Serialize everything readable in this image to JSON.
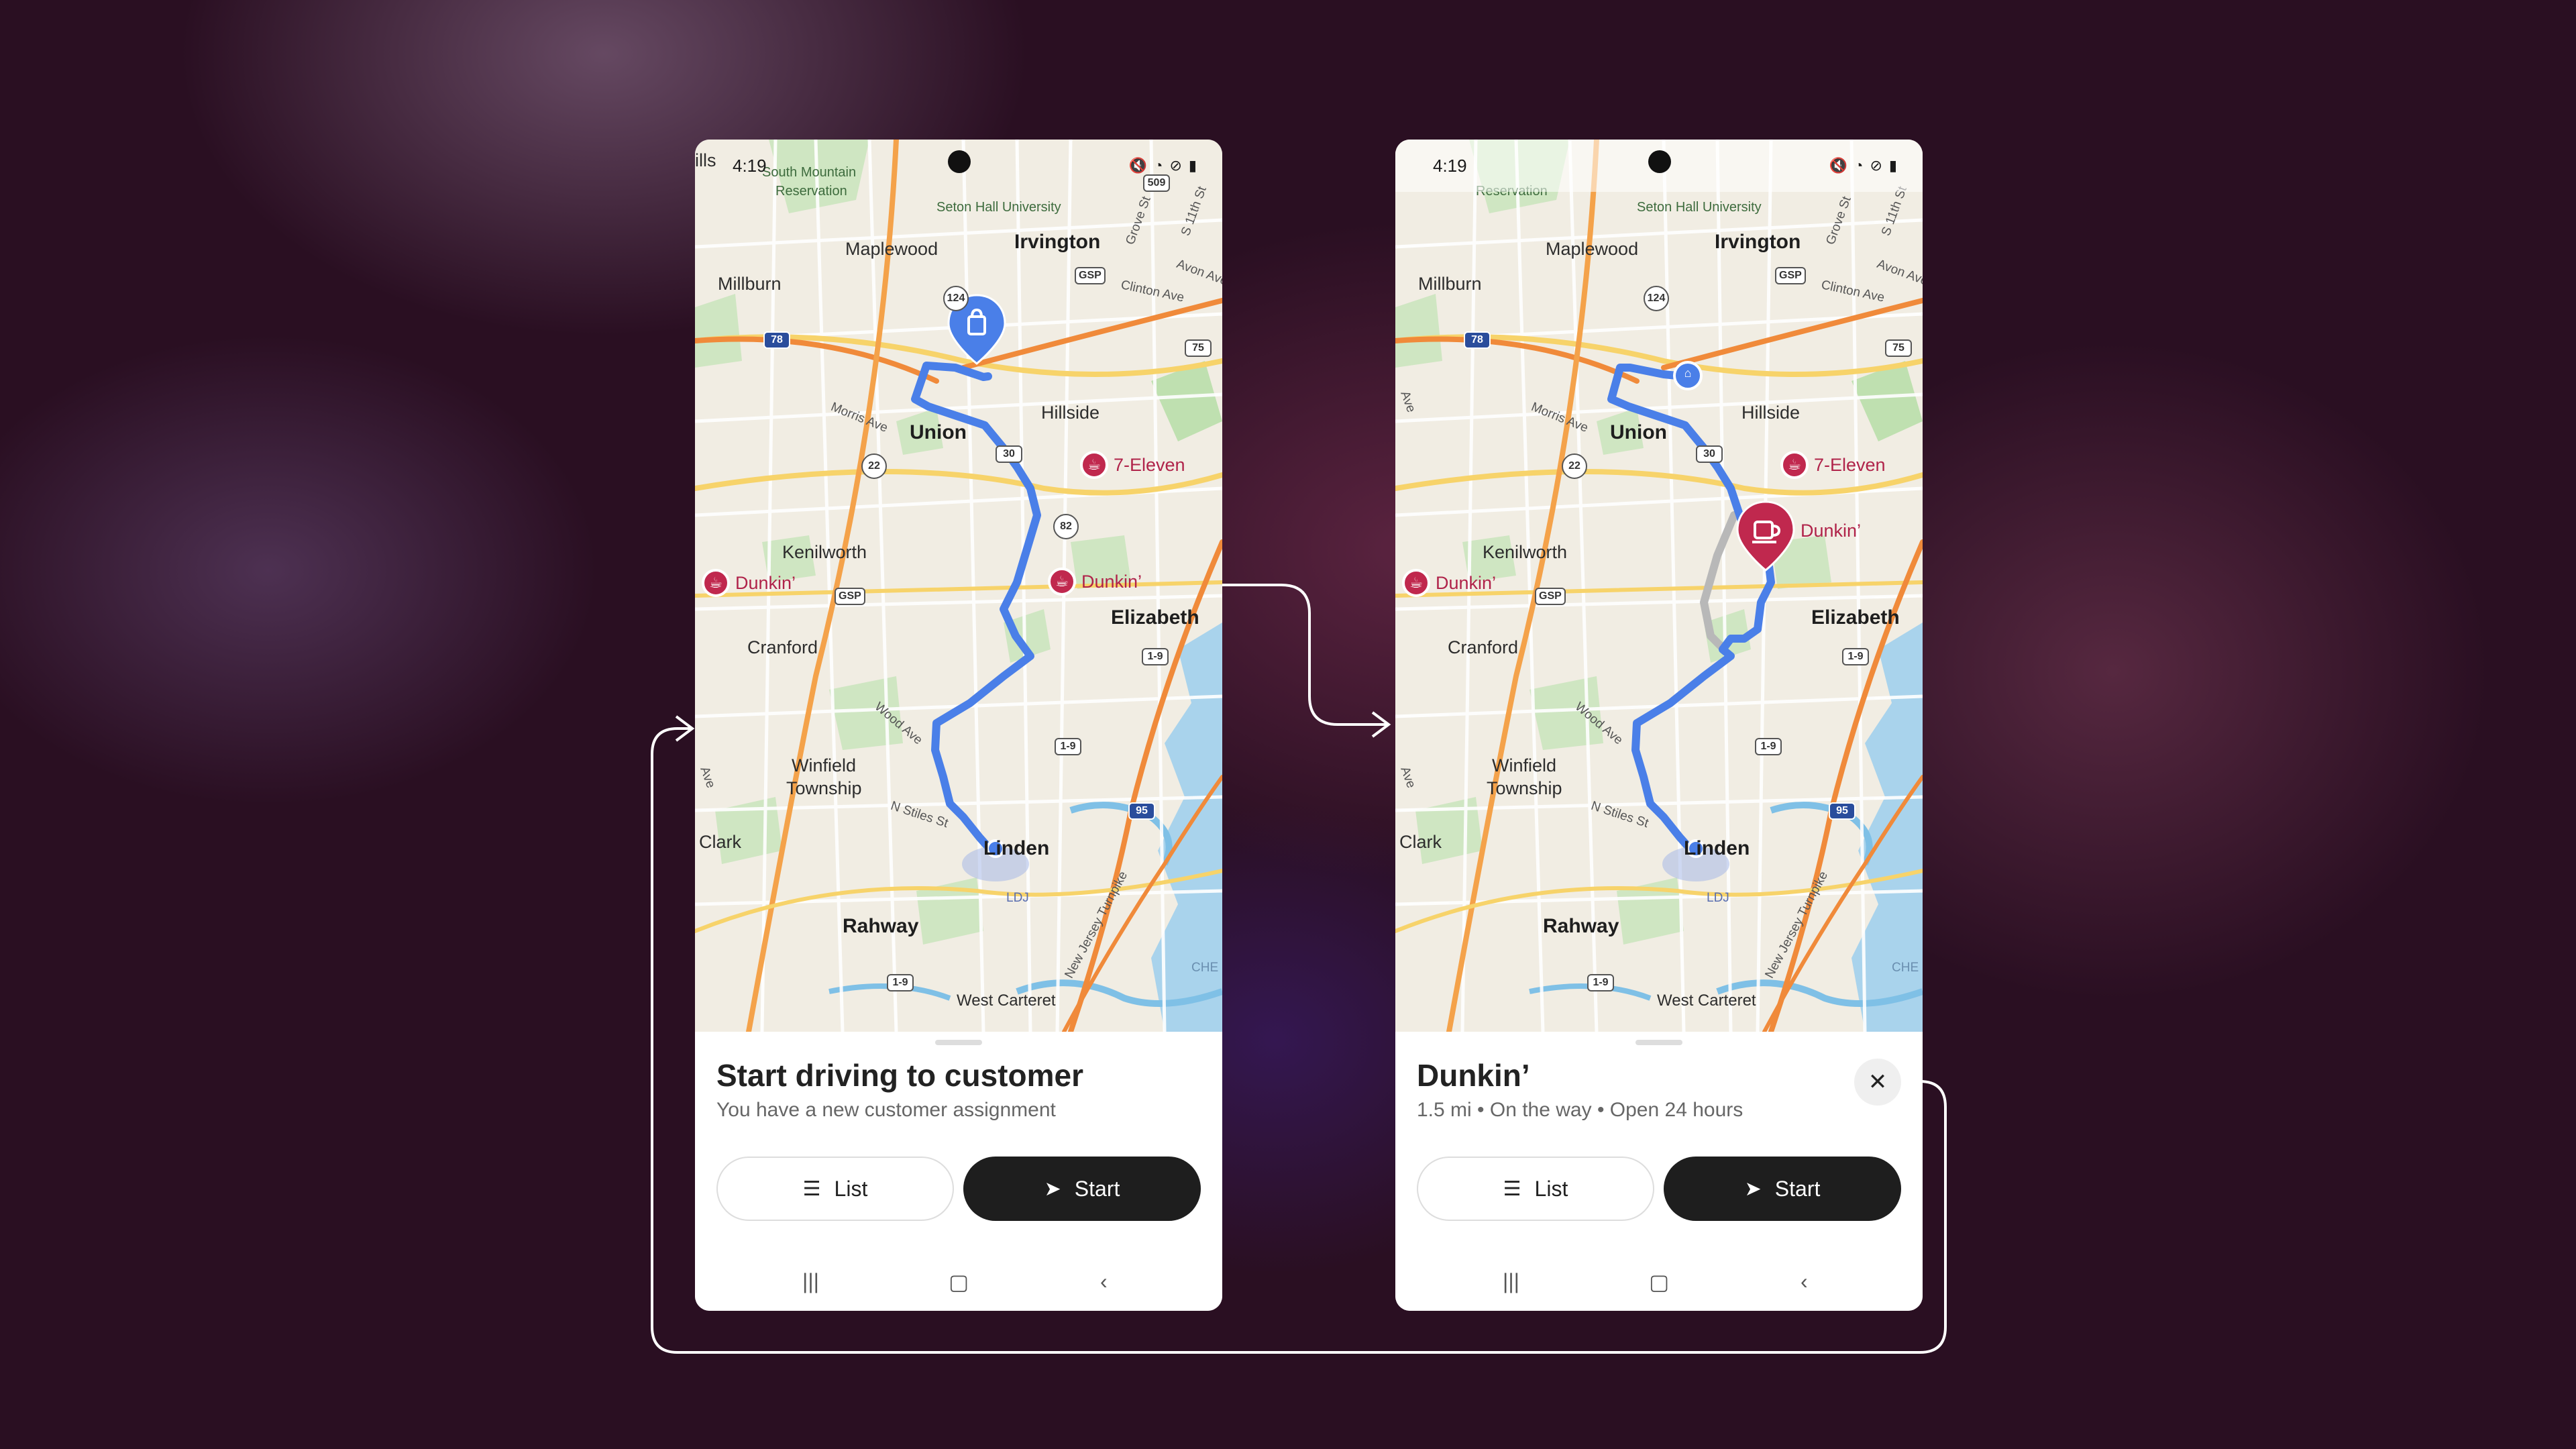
{
  "colors": {
    "route": "#4a7fe8",
    "route_alt": "#b8b8b8",
    "poi": "#c0284e",
    "primary_button": "#1e1e1e"
  },
  "map_labels": {
    "hills": "ills",
    "south_mountain": "South Mountain",
    "reservation": "Reservation",
    "seton_hall": "Seton Hall University",
    "maplewood": "Maplewood",
    "irvington": "Irvington",
    "millburn": "Millburn",
    "hillside": "Hillside",
    "union": "Union",
    "kenilworth": "Kenilworth",
    "elizabeth": "Elizabeth",
    "cranford": "Cranford",
    "winfield": "Winfield",
    "township": "Township",
    "clark": "Clark",
    "linden": "Linden",
    "ldj": "LDJ",
    "rahway": "Rahway",
    "west_carteret": "West Carteret",
    "morris_ave": "Morris Ave",
    "wood_ave": "Wood Ave",
    "n_stiles_st": "N Stiles St",
    "grove_st": "Grove St",
    "s_11th_st": "S 11th St",
    "avon_ave": "Avon Ave",
    "clinton_ave": "Clinton Ave",
    "nj_turnpike": "New Jersey Turnpike",
    "che": "CHE",
    "ave": "Ave"
  },
  "shields": {
    "s509": "509",
    "s124": "124",
    "gsp": "GSP",
    "s78": "78",
    "s75": "75",
    "s22": "22",
    "s82": "82",
    "s1_9": "1-9",
    "s95": "95",
    "s30": "30"
  },
  "pois": {
    "seven_eleven": "7-Eleven",
    "dunkin": "Dunkin’"
  },
  "screen1": {
    "time": "4:19",
    "title": "Start driving to customer",
    "subtitle": "You have a new customer assignment",
    "list_label": "List",
    "start_label": "Start"
  },
  "screen2": {
    "time": "4:19",
    "title": "Dunkin’",
    "subtitle": "1.5 mi • On the way • Open 24 hours",
    "list_label": "List",
    "start_label": "Start"
  },
  "icons": {
    "list": "list-icon",
    "navigate": "navigation-arrow-icon",
    "close": "close-icon",
    "coffee": "coffee-cup-icon",
    "shopping_bag": "shopping-bag-icon",
    "recents": "recents-icon",
    "home": "home-icon",
    "back": "back-icon"
  }
}
